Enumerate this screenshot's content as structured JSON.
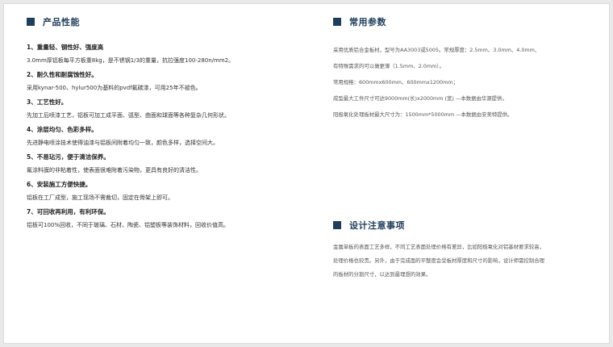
{
  "left_section": {
    "title": "产品性能",
    "items": [
      {
        "title": "1、重量轻、钢性好、强度高",
        "body": "3.0mm厚铝板每平方板重8kg，是不锈钢1/3的重量，抗拉强度100-280n/mm2。"
      },
      {
        "title": "2、耐久性和耐腐蚀性好。",
        "body": "采用kynar-500、hylur500为基料的pvdf氟碳漆，可用25年不褪色。"
      },
      {
        "title": "3、工艺性好。",
        "body": "先加工后喷漆工艺，铝板可加工成平面、弧型、曲面和球面等各种复杂几何形状。"
      },
      {
        "title": "4、涂层均匀、色彩多样。",
        "body": "先进静电喷涂技术使得油漆与铝板间附着均匀一致，颜色多样，选择空间大。"
      },
      {
        "title": "5、不易玷污，便于清洁保养。",
        "body": "氟涂料膜的非粘着性，使表面很难附着污染物，更具有良好的清洁性。"
      },
      {
        "title": "6、安装施工方便快捷。",
        "body": "铝板在工厂成型，施工现场不需裁切，固定在骨架上即可。"
      },
      {
        "title": "7、可回收再利用，有利环保。",
        "body": "铝板可100%回收，不同于玻璃、石材、陶瓷、铝塑板等装饰材料，回收价值高。"
      }
    ]
  },
  "right_section": {
    "title": "常用参数",
    "paragraphs": [
      "采用优质铝合金板材，型号为AA3003或5005。常规厚度：2.5mm、3.0mm、4.0mm、",
      "有特殊需求的可以做更薄（1.5mm、2.0mm）。",
      "常用规格：600mmx600mm、600mmx1200mm；",
      "成型最大工件尺寸可达9000mm(长)x2000mm (宽) —本数据由华源提供。",
      "阳极氧化处理板材最大尺寸为：1500mm*5000mm —本数据由安美特提供。"
    ]
  },
  "notes_section": {
    "title": "设计注意事项",
    "paragraphs": [
      "金属单板的表面工艺多样，不同工艺表面处理价格有差异，比如阳极氧化对铝基材要求较高，",
      "处理价格也较贵。另外，由于完成面的平整度会受板材厚度和尺寸的影响，设计师需控制合理",
      "的板材的分割尺寸，以达到最理想的效果。"
    ]
  },
  "colors": {
    "accent": "#1f3d5c",
    "background": "#e9e9e9",
    "card": "#ffffff"
  }
}
